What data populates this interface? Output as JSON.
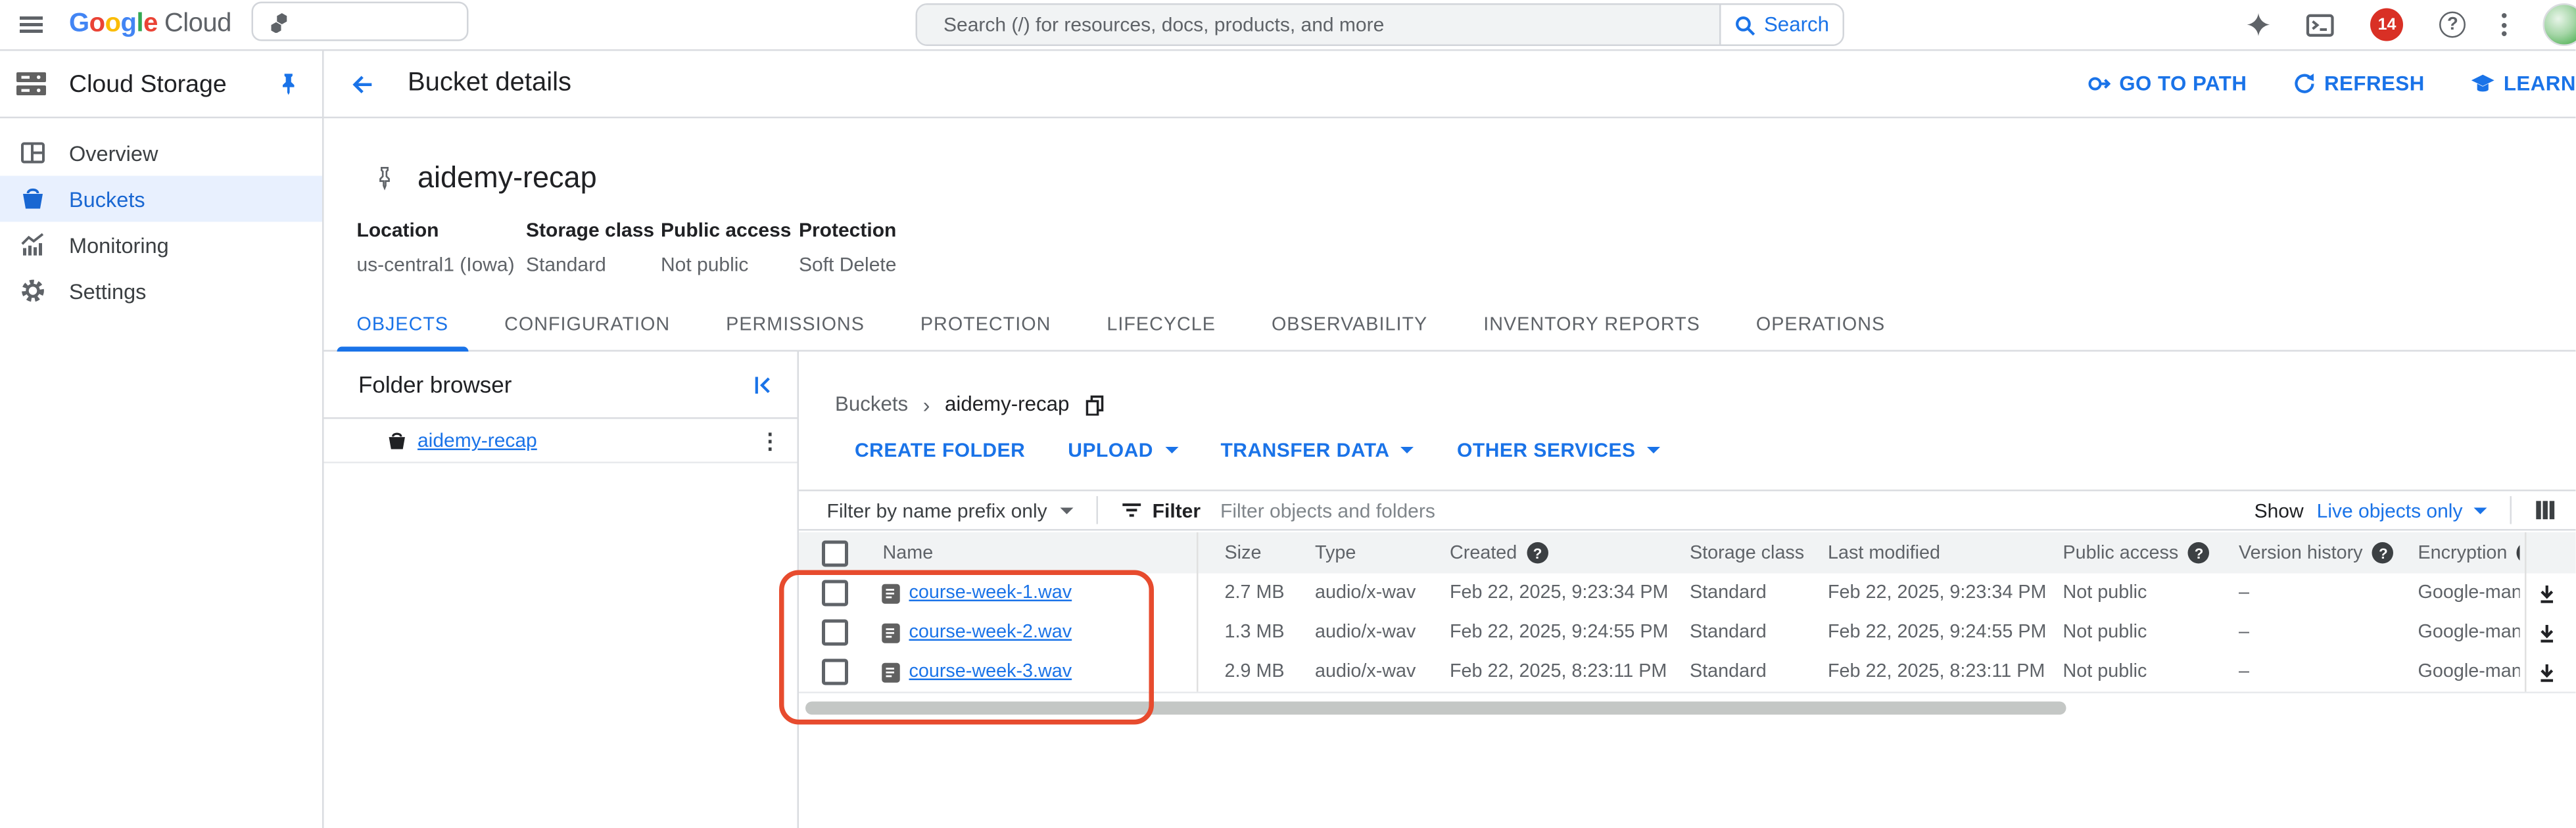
{
  "topbar": {
    "logo": {
      "letters": [
        "G",
        "o",
        "o",
        "g",
        "l",
        "e"
      ],
      "suffix": "Cloud"
    },
    "search_placeholder": "Search (/) for resources, docs, products, and more",
    "search_button": "Search",
    "notifications_count": "14"
  },
  "sidebar": {
    "title": "Cloud Storage",
    "items": [
      {
        "label": "Overview"
      },
      {
        "label": "Buckets"
      },
      {
        "label": "Monitoring"
      },
      {
        "label": "Settings"
      }
    ]
  },
  "page_header": {
    "title": "Bucket details",
    "actions": [
      {
        "label": "GO TO PATH"
      },
      {
        "label": "REFRESH"
      },
      {
        "label": "LEARN"
      }
    ]
  },
  "bucket": {
    "name": "aidemy-recap",
    "meta": [
      {
        "label": "Location",
        "value": "us-central1 (Iowa)"
      },
      {
        "label": "Storage class",
        "value": "Standard"
      },
      {
        "label": "Public access",
        "value": "Not public"
      },
      {
        "label": "Protection",
        "value": "Soft Delete"
      }
    ]
  },
  "tabs": [
    {
      "label": "OBJECTS",
      "active": true
    },
    {
      "label": "CONFIGURATION"
    },
    {
      "label": "PERMISSIONS"
    },
    {
      "label": "PROTECTION"
    },
    {
      "label": "LIFECYCLE"
    },
    {
      "label": "OBSERVABILITY"
    },
    {
      "label": "INVENTORY REPORTS"
    },
    {
      "label": "OPERATIONS"
    }
  ],
  "folder_browser": {
    "title": "Folder browser",
    "items": [
      {
        "label": "aidemy-recap"
      }
    ]
  },
  "objects": {
    "breadcrumb": {
      "root": "Buckets",
      "current": "aidemy-recap"
    },
    "toolbar": [
      {
        "label": "CREATE FOLDER"
      },
      {
        "label": "UPLOAD"
      },
      {
        "label": "TRANSFER DATA"
      },
      {
        "label": "OTHER SERVICES"
      }
    ],
    "filter": {
      "prefix_label": "Filter by name prefix only",
      "filter_label": "Filter",
      "placeholder": "Filter objects and folders",
      "show_label": "Show",
      "show_value": "Live objects only"
    },
    "table": {
      "columns": [
        {
          "label": "Name"
        },
        {
          "label": "Size"
        },
        {
          "label": "Type"
        },
        {
          "label": "Created",
          "help": true
        },
        {
          "label": "Storage class"
        },
        {
          "label": "Last modified"
        },
        {
          "label": "Public access",
          "help": true
        },
        {
          "label": "Version history",
          "help": true
        },
        {
          "label": "Encryption",
          "help": true
        }
      ],
      "rows": [
        {
          "name": "course-week-1.wav",
          "size": "2.7 MB",
          "type": "audio/x-wav",
          "created": "Feb 22, 2025, 9:23:34 PM",
          "storage_class": "Standard",
          "last_modified": "Feb 22, 2025, 9:23:34 PM",
          "public_access": "Not public",
          "version_history": "–",
          "encryption": "Google-mana"
        },
        {
          "name": "course-week-2.wav",
          "size": "1.3 MB",
          "type": "audio/x-wav",
          "created": "Feb 22, 2025, 9:24:55 PM",
          "storage_class": "Standard",
          "last_modified": "Feb 22, 2025, 9:24:55 PM",
          "public_access": "Not public",
          "version_history": "–",
          "encryption": "Google-mana"
        },
        {
          "name": "course-week-3.wav",
          "size": "2.9 MB",
          "type": "audio/x-wav",
          "created": "Feb 22, 2025, 8:23:11 PM",
          "storage_class": "Standard",
          "last_modified": "Feb 22, 2025, 8:23:11 PM",
          "public_access": "Not public",
          "version_history": "–",
          "encryption": "Google-mana"
        }
      ]
    }
  },
  "colors": {
    "accent": "#1a73e8",
    "annotation": "#e74b2e",
    "badge_red": "#d93025",
    "selected_bg": "#e8f0fe"
  }
}
